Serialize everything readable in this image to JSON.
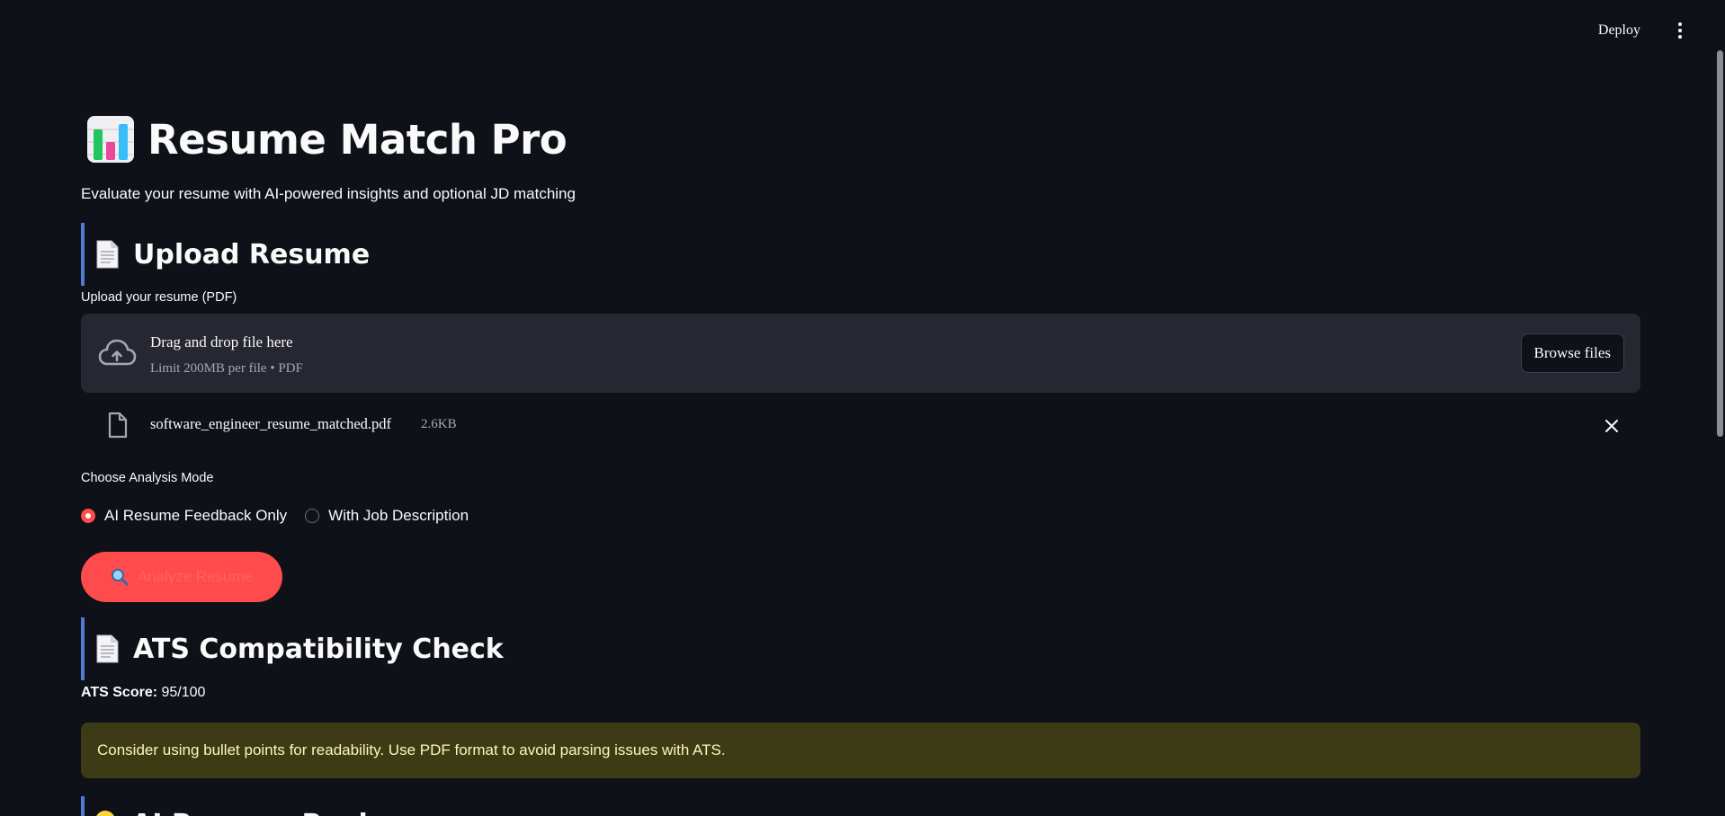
{
  "header": {
    "deploy_label": "Deploy",
    "menu_icon": "kebab-menu-icon"
  },
  "app": {
    "title": "Resume Match Pro",
    "title_icon": "bar-chart-icon",
    "subtitle": "Evaluate your resume with AI-powered insights and optional JD matching"
  },
  "upload": {
    "heading": "Upload Resume",
    "heading_icon": "document-icon",
    "field_label": "Upload your resume (PDF)",
    "dropzone_title": "Drag and drop file here",
    "dropzone_limit": "Limit 200MB per file • PDF",
    "browse_label": "Browse files",
    "file": {
      "name": "software_engineer_resume_matched.pdf",
      "size": "2.6KB"
    }
  },
  "mode": {
    "label": "Choose Analysis Mode",
    "options": [
      {
        "label": "AI Resume Feedback Only",
        "selected": true
      },
      {
        "label": "With Job Description",
        "selected": false
      }
    ]
  },
  "analyze": {
    "label": "Analyze Resume",
    "icon": "magnifier-icon"
  },
  "ats": {
    "heading": "ATS Compatibility Check",
    "heading_icon": "document-icon",
    "score_label": "ATS Score:",
    "score_value": " 95/100",
    "warning": "Consider using bullet points for readability. Use PDF format to avoid parsing issues with ATS."
  },
  "next_section": {
    "heading": "AI Resume Review",
    "heading_icon": "lightbulb-icon"
  },
  "colors": {
    "background": "#0e1117",
    "accent": "#ff4b4b",
    "section_border": "#4f7bd6",
    "warning_bg": "#3d3b15",
    "warning_text": "#fdf6b8"
  }
}
